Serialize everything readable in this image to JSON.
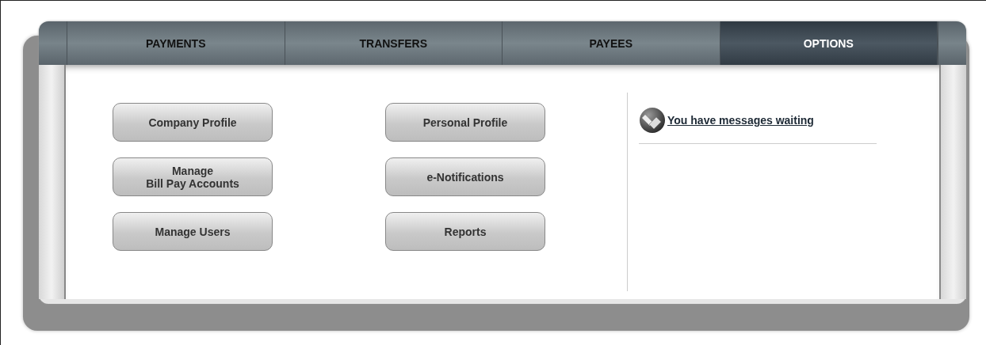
{
  "tabs": [
    {
      "label": "PAYMENTS",
      "selected": false
    },
    {
      "label": "TRANSFERS",
      "selected": false
    },
    {
      "label": "PAYEES",
      "selected": false
    },
    {
      "label": "OPTIONS",
      "selected": true
    }
  ],
  "button_columns": [
    [
      "Company Profile",
      "Manage\nBill Pay Accounts",
      "Manage Users"
    ],
    [
      "Personal Profile",
      "e-Notifications",
      "Reports"
    ]
  ],
  "messages_link": "You have messages waiting"
}
